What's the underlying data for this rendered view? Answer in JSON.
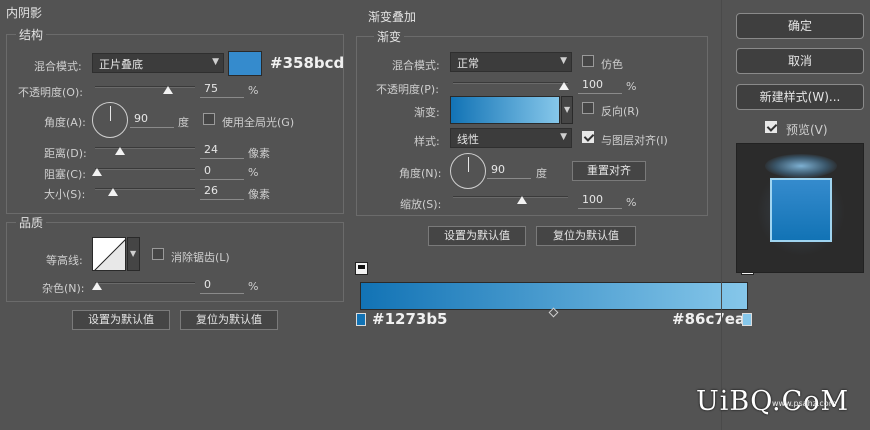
{
  "inner_shadow": {
    "title": "内阴影",
    "structure": {
      "title": "结构",
      "blend_mode_label": "混合模式:",
      "blend_mode_value": "正片叠底",
      "color_hex": "#358bcd",
      "color_hex_label": "#358bcd",
      "opacity_label": "不透明度(O):",
      "opacity_value": "75",
      "opacity_unit": "%",
      "opacity_level": 75,
      "angle_label": "角度(A):",
      "angle_value": "90",
      "angle_unit": "度",
      "global_light_label": "使用全局光(G)",
      "global_light_checked": false,
      "distance_label": "距离(D):",
      "distance_value": "24",
      "distance_unit": "像素",
      "distance_level": 24,
      "choke_label": "阻塞(C):",
      "choke_value": "0",
      "choke_unit": "%",
      "choke_level": 0,
      "size_label": "大小(S):",
      "size_value": "26",
      "size_unit": "像素",
      "size_level": 26
    },
    "quality": {
      "title": "品质",
      "contour_label": "等高线:",
      "anti_alias_label": "消除锯齿(L)",
      "anti_alias_checked": false,
      "noise_label": "杂色(N):",
      "noise_value": "0",
      "noise_unit": "%",
      "noise_level": 0
    },
    "make_default": "设置为默认值",
    "reset_default": "复位为默认值"
  },
  "gradient_overlay": {
    "title": "渐变叠加",
    "group_title": "渐变",
    "blend_mode_label": "混合模式:",
    "blend_mode_value": "正常",
    "dither_label": "仿色",
    "dither_checked": false,
    "opacity_label": "不透明度(P):",
    "opacity_value": "100",
    "opacity_unit": "%",
    "opacity_level": 100,
    "gradient_label": "渐变:",
    "reverse_label": "反向(R)",
    "reverse_checked": false,
    "style_label": "样式:",
    "style_value": "线性",
    "align_label": "与图层对齐(I)",
    "align_checked": true,
    "angle_label": "角度(N):",
    "angle_value": "90",
    "angle_unit": "度",
    "reset_align": "重置对齐",
    "scale_label": "缩放(S):",
    "scale_value": "100",
    "scale_unit": "%",
    "scale_level": 100,
    "make_default": "设置为默认值",
    "reset_default": "复位为默认值"
  },
  "gradient_bar": {
    "start_color": "#1273b5",
    "end_color": "#86c7ea",
    "start_label": "#1273b5",
    "end_label": "#86c7ea"
  },
  "buttons": {
    "ok": "确定",
    "cancel": "取消",
    "new_style": "新建样式(W)...",
    "preview_label": "预览(V)",
    "preview_checked": true
  },
  "watermark": {
    "text": "UiBQ.CoM",
    "small": "www.psahz.com"
  }
}
